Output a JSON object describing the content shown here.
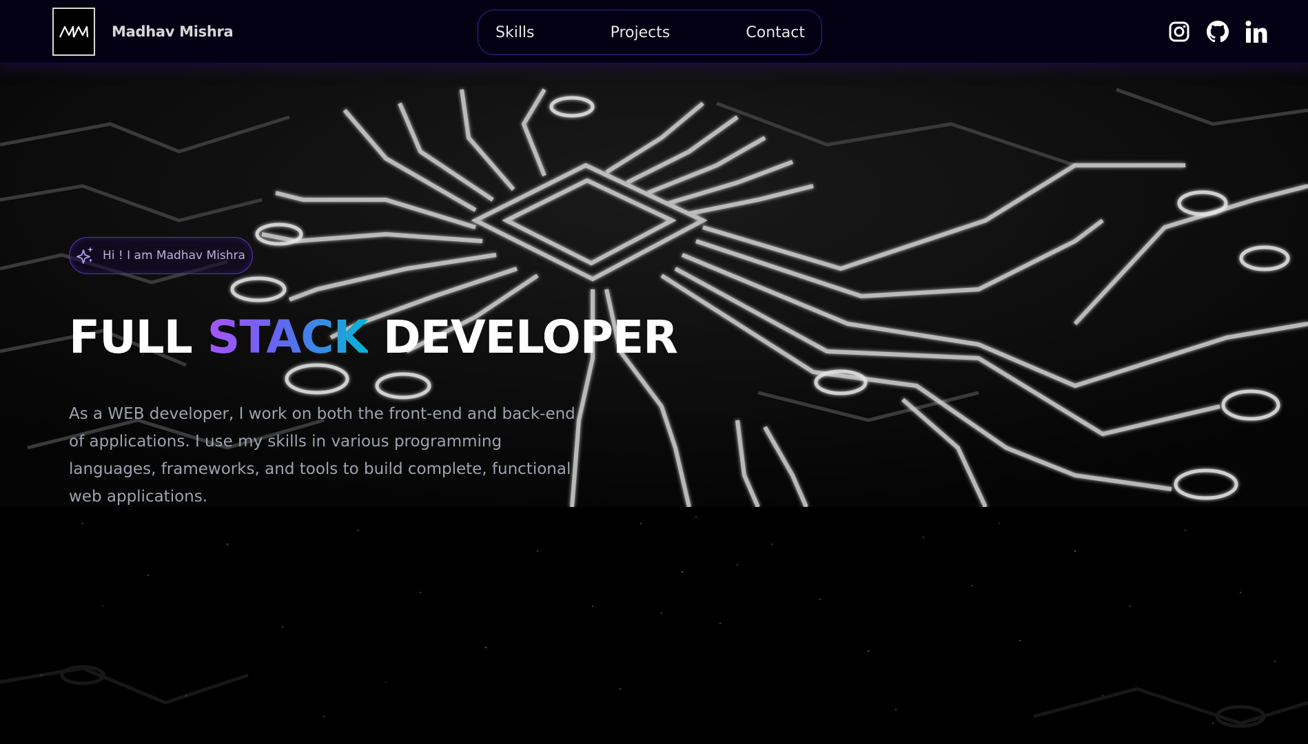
{
  "header": {
    "logo_text": "MM",
    "brand_name": "Madhav Mishra",
    "nav": [
      {
        "label": "Skills"
      },
      {
        "label": "Projects"
      },
      {
        "label": "Contact"
      }
    ],
    "socials": [
      {
        "icon": "instagram-icon"
      },
      {
        "icon": "github-icon"
      },
      {
        "icon": "linkedin-icon"
      }
    ]
  },
  "hero": {
    "greeting": "Hi ! I am Madhav Mishra",
    "headline": {
      "part1": "FULL",
      "highlight": "STACK",
      "part2": "DEVELOPER"
    },
    "description": "As a WEB developer, I work on both the front-end and back-end of applications. I use my skills in various programming languages, frameworks, and tools to build complete, functional web applications."
  },
  "colors": {
    "background": "#000000",
    "header_bg": "#030014",
    "accent_purple": "#7042f8",
    "gradient_start": "#a855f7",
    "gradient_end": "#06b6d4",
    "text_muted": "#9ca3af"
  }
}
